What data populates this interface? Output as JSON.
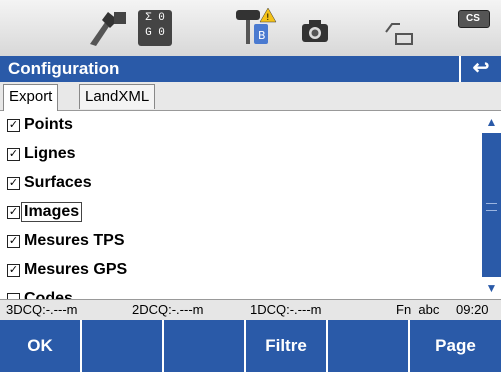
{
  "status": {
    "counts_top": "Σ 0",
    "counts_bottom": "G 0",
    "icons": [
      "prism-target-icon",
      "counter-icon",
      "gnss-bluetooth-warning-icon",
      "camera-icon",
      "line-tool-icon",
      "cs-controller-icon"
    ],
    "cs_label": "CS"
  },
  "titlebar": {
    "title": "Configuration",
    "back_label": "↩"
  },
  "tabs": [
    {
      "label": "Export",
      "active": true
    },
    {
      "label": "LandXML",
      "active": false
    }
  ],
  "items": [
    {
      "label": "Points",
      "checked": true
    },
    {
      "label": "Lignes",
      "checked": true
    },
    {
      "label": "Surfaces",
      "checked": true
    },
    {
      "label": "Images",
      "checked": true,
      "selected": true
    },
    {
      "label": "Mesures TPS",
      "checked": true
    },
    {
      "label": "Mesures GPS",
      "checked": true
    },
    {
      "label": "Codes",
      "checked": false
    }
  ],
  "info": {
    "dcq3": "3DCQ:-.---m",
    "dcq2": "2DCQ:-.---m",
    "dcq1": "1DCQ:-.---m",
    "mode": "Fn  abc",
    "time": "09:20"
  },
  "fkeys": [
    "OK",
    "",
    "",
    "Filtre",
    "",
    "Page"
  ],
  "colors": {
    "accent": "#2a5aa8"
  }
}
